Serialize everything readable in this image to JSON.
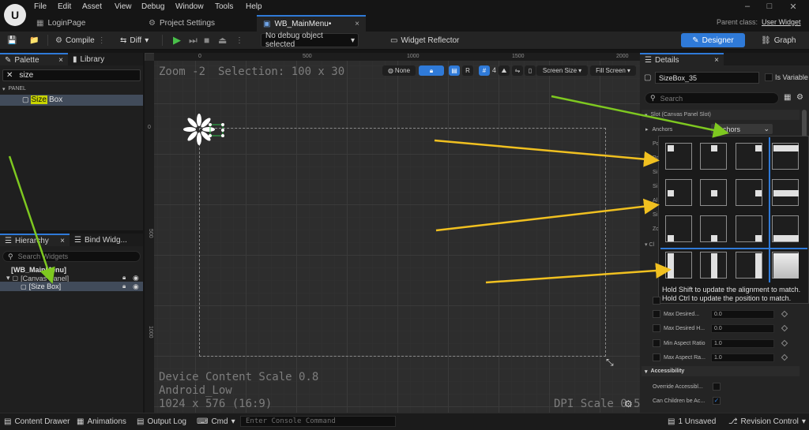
{
  "menu": [
    "File",
    "Edit",
    "Asset",
    "View",
    "Debug",
    "Window",
    "Tools",
    "Help"
  ],
  "tabs": [
    {
      "label": "LoginPage"
    },
    {
      "label": "Project Settings"
    },
    {
      "label": "WB_MainMenu•"
    }
  ],
  "parent_class": {
    "label": "Parent class:",
    "value": "User Widget"
  },
  "toolbar": {
    "compile": "Compile",
    "diff": "Diff",
    "debug_object": "No debug object selected",
    "widget_reflector": "Widget Reflector",
    "designer": "Designer",
    "graph": "Graph"
  },
  "palette": {
    "tab_label": "Palette",
    "library_label": "Library",
    "search_value": "size",
    "category": "PANEL",
    "item_highlight": "Size",
    "item_rest": " Box"
  },
  "hierarchy": {
    "tab_label": "Hierarchy",
    "bind_tab_label": "Bind Widg...",
    "search_placeholder": "Search Widgets",
    "root": "[WB_MainMenu]",
    "canvas": "[Canvas Panel]",
    "sizebox": "[Size Box]"
  },
  "viewport": {
    "zoom": "Zoom -2",
    "selection": "Selection: 100 x 30",
    "none_label": "None",
    "r_label": "R",
    "grid_value": "4",
    "screen_size": "Screen Size",
    "fill_screen": "Fill Screen",
    "content_scale": "Device Content Scale 0.8",
    "device": "Android_Low",
    "resolution": "1024 x 576 (16:9)",
    "dpi": "DPI Scale 0.53",
    "ruler_h": [
      "0",
      "500",
      "1000",
      "1500",
      "2000"
    ],
    "ruler_v": [
      "0",
      "500",
      "1000"
    ]
  },
  "details": {
    "tab_label": "Details",
    "name_value": "SizeBox_35",
    "is_variable": "Is Variable",
    "search_placeholder": "Search",
    "slot_label": "Slot (Canvas Panel Slot)",
    "anchors_label": "Anchors",
    "anchors_dropdown": "Anchors",
    "rows": [
      {
        "label": "Max Desired...",
        "value": "0.0"
      },
      {
        "label": "Max Desired H...",
        "value": "0.0"
      },
      {
        "label": "Min Aspect Ratio",
        "value": "1.0"
      },
      {
        "label": "Max Aspect Ra...",
        "value": "1.0"
      }
    ],
    "accessibility_label": "Accessibility",
    "override_label": "Override Accessibl...",
    "can_children_label": "Can Children be Ac..."
  },
  "anchor_popup": {
    "hint1": "Hold Shift to update the alignment to match.",
    "hint2": "Hold Ctrl to update the position to match."
  },
  "bottom": {
    "content_drawer": "Content Drawer",
    "animations": "Animations",
    "output_log": "Output Log",
    "cmd": "Cmd",
    "console_placeholder": "Enter Console Command",
    "unsaved": "1 Unsaved",
    "revision": "Revision Control"
  },
  "colors": {
    "accent": "#2f7ad8",
    "annotation_arrow_green": "#7ec820",
    "annotation_arrow_yellow": "#f0c020"
  }
}
